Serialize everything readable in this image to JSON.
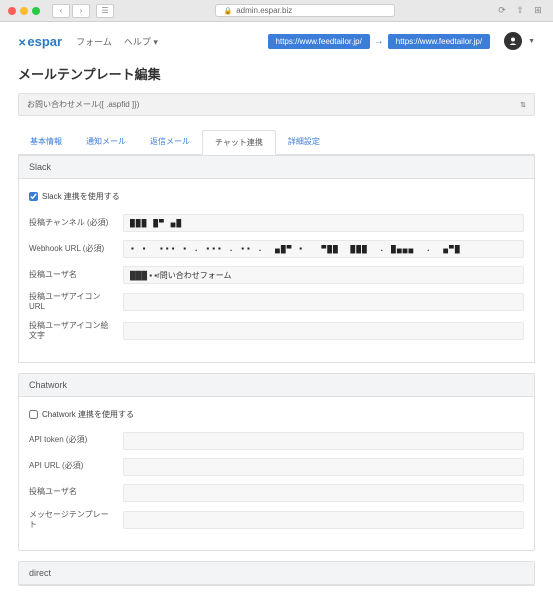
{
  "chrome": {
    "url": "admin.espar.biz"
  },
  "header": {
    "logo": "espar",
    "nav": {
      "forms": "フォーム",
      "help": "ヘルプ ▾"
    },
    "pill1": "https://www.feedtailor.jp/",
    "pill2": "https://www.feedtailor.jp/"
  },
  "page_title": "メールテンプレート編集",
  "selector": "お問い合わせメール([ .aspfid ]})",
  "tabs": {
    "basic": "基本情報",
    "notify": "通知メール",
    "reply": "返信メール",
    "chat": "チャット連携",
    "detail": "詳細設定"
  },
  "slack": {
    "title": "Slack",
    "enable_label": "Slack 連携を使用する",
    "channel_label": "投稿チャンネル (必須)",
    "channel_value": "███ █▀ ▄█",
    "webhook_label": "Webhook URL (必須)",
    "webhook_value": "▪ ▪  ▪▪▪ ▪ . ▪▪▪ . ▪▪ .  ▄█▀ ▪   ▀██  ███  . █▄▄▄  .  ▄▀█",
    "username_label": "投稿ユーザ名",
    "username_value": "███ ▪ ▪r問い合わせフォーム",
    "iconurl_label": "投稿ユーザアイコンURL",
    "iconurl_value": "",
    "emoji_label": "投稿ユーザアイコン絵文字",
    "emoji_value": ""
  },
  "chatwork": {
    "title": "Chatwork",
    "enable_label": "Chatwork 連携を使用する",
    "token_label": "API token (必須)",
    "token_value": "",
    "url_label": "API URL (必須)",
    "url_value": "",
    "username_label": "投稿ユーザ名",
    "username_value": "",
    "template_label": "メッセージテンプレート",
    "template_value": ""
  },
  "direct": {
    "title": "direct"
  }
}
